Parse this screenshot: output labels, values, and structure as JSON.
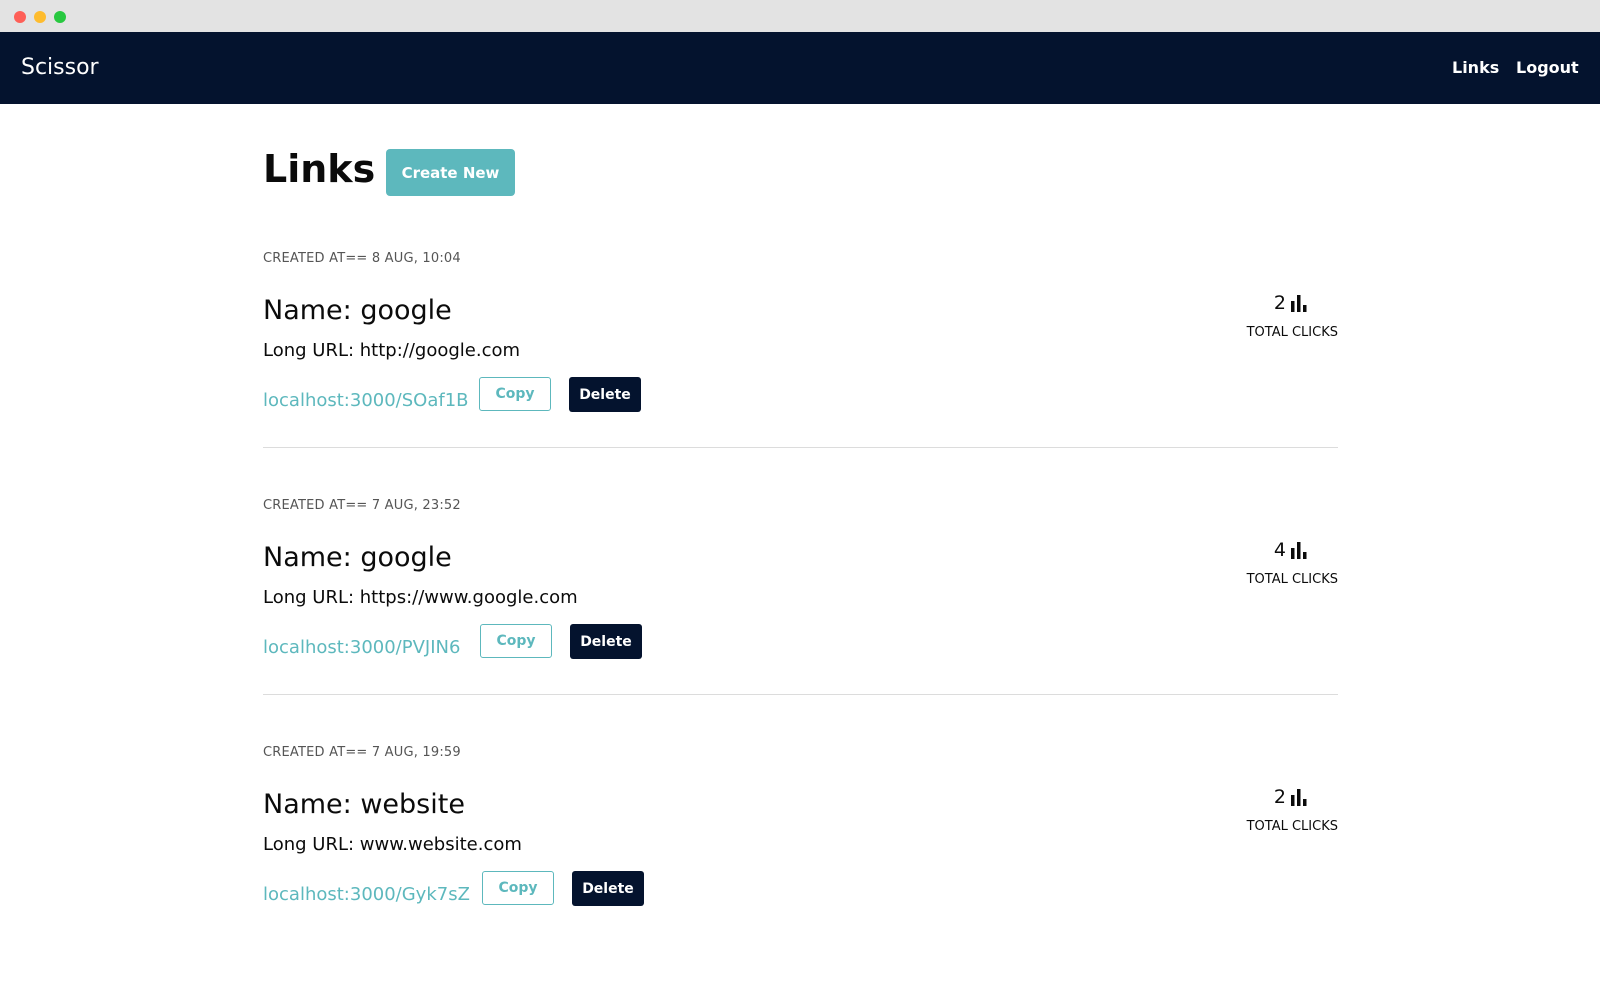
{
  "window": {
    "controls": {
      "close_color": "#fe5f57",
      "minimize_color": "#febc2e",
      "maximize_color": "#28c840"
    }
  },
  "navbar": {
    "brand": "Scissor",
    "links_label": "Links",
    "logout_label": "Logout",
    "background": "#04132e"
  },
  "main": {
    "title": "Links",
    "create_label": "Create New",
    "accent": "#5db8bd"
  },
  "links": [
    {
      "created_at": "CREATED AT== 8 AUG, 10:04",
      "name": "Name: google",
      "long_url": "Long URL: http://google.com",
      "short_url": "localhost:3000/SOaf1B",
      "copy_label": "Copy",
      "delete_label": "Delete",
      "clicks": "2",
      "clicks_label": "TOTAL CLICKS",
      "stats_icon": "bar-chart-icon"
    },
    {
      "created_at": "CREATED AT== 7 AUG, 23:52",
      "name": "Name: google",
      "long_url": "Long URL: https://www.google.com",
      "short_url": "localhost:3000/PVJIN6",
      "copy_label": "Copy",
      "delete_label": "Delete",
      "clicks": "4",
      "clicks_label": "TOTAL CLICKS",
      "stats_icon": "bar-chart-icon"
    },
    {
      "created_at": "CREATED AT== 7 AUG, 19:59",
      "name": "Name: website",
      "long_url": "Long URL: www.website.com",
      "short_url": "localhost:3000/Gyk7sZ",
      "copy_label": "Copy",
      "delete_label": "Delete",
      "clicks": "2",
      "clicks_label": "TOTAL CLICKS",
      "stats_icon": "bar-chart-icon"
    }
  ]
}
